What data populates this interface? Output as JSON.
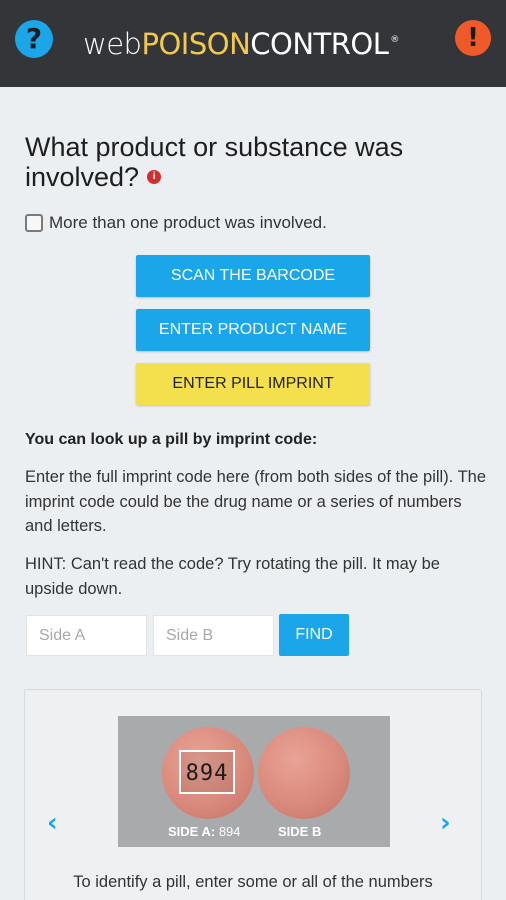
{
  "header": {
    "help_icon": "?",
    "alert_icon": "!",
    "logo_web": "web",
    "logo_poison": "POISON",
    "logo_control": "CONTROL",
    "logo_reg": "®",
    "colors": {
      "bar": "#333538",
      "help": "#1aa6e8",
      "alert": "#f05a28",
      "poison": "#f2c94c"
    }
  },
  "question": {
    "text": "What product or substance was involved?",
    "info_icon": "i"
  },
  "multi_product": {
    "label": "More than one product was involved.",
    "checked": false
  },
  "buttons": {
    "scan": "SCAN THE BARCODE",
    "product_name": "ENTER PRODUCT NAME",
    "pill_imprint": "ENTER PILL IMPRINT"
  },
  "lookup": {
    "title": "You can look up a pill by imprint code:",
    "description": "Enter the full imprint code here (from both sides of the pill). The imprint code could be the drug name or a series of numbers and letters.",
    "hint": "HINT: Can't read the code? Try rotating the pill. It may be upside down.",
    "side_a_placeholder": "Side A",
    "side_b_placeholder": "Side B",
    "find_label": "FIND"
  },
  "example_card": {
    "prev_icon": "‹",
    "next_icon": "›",
    "imprint": "894",
    "side_a_label": "SIDE A:",
    "side_a_value": " 894",
    "side_b_label": "SIDE B",
    "caption": "To identify a pill, enter some or all of the numbers"
  }
}
